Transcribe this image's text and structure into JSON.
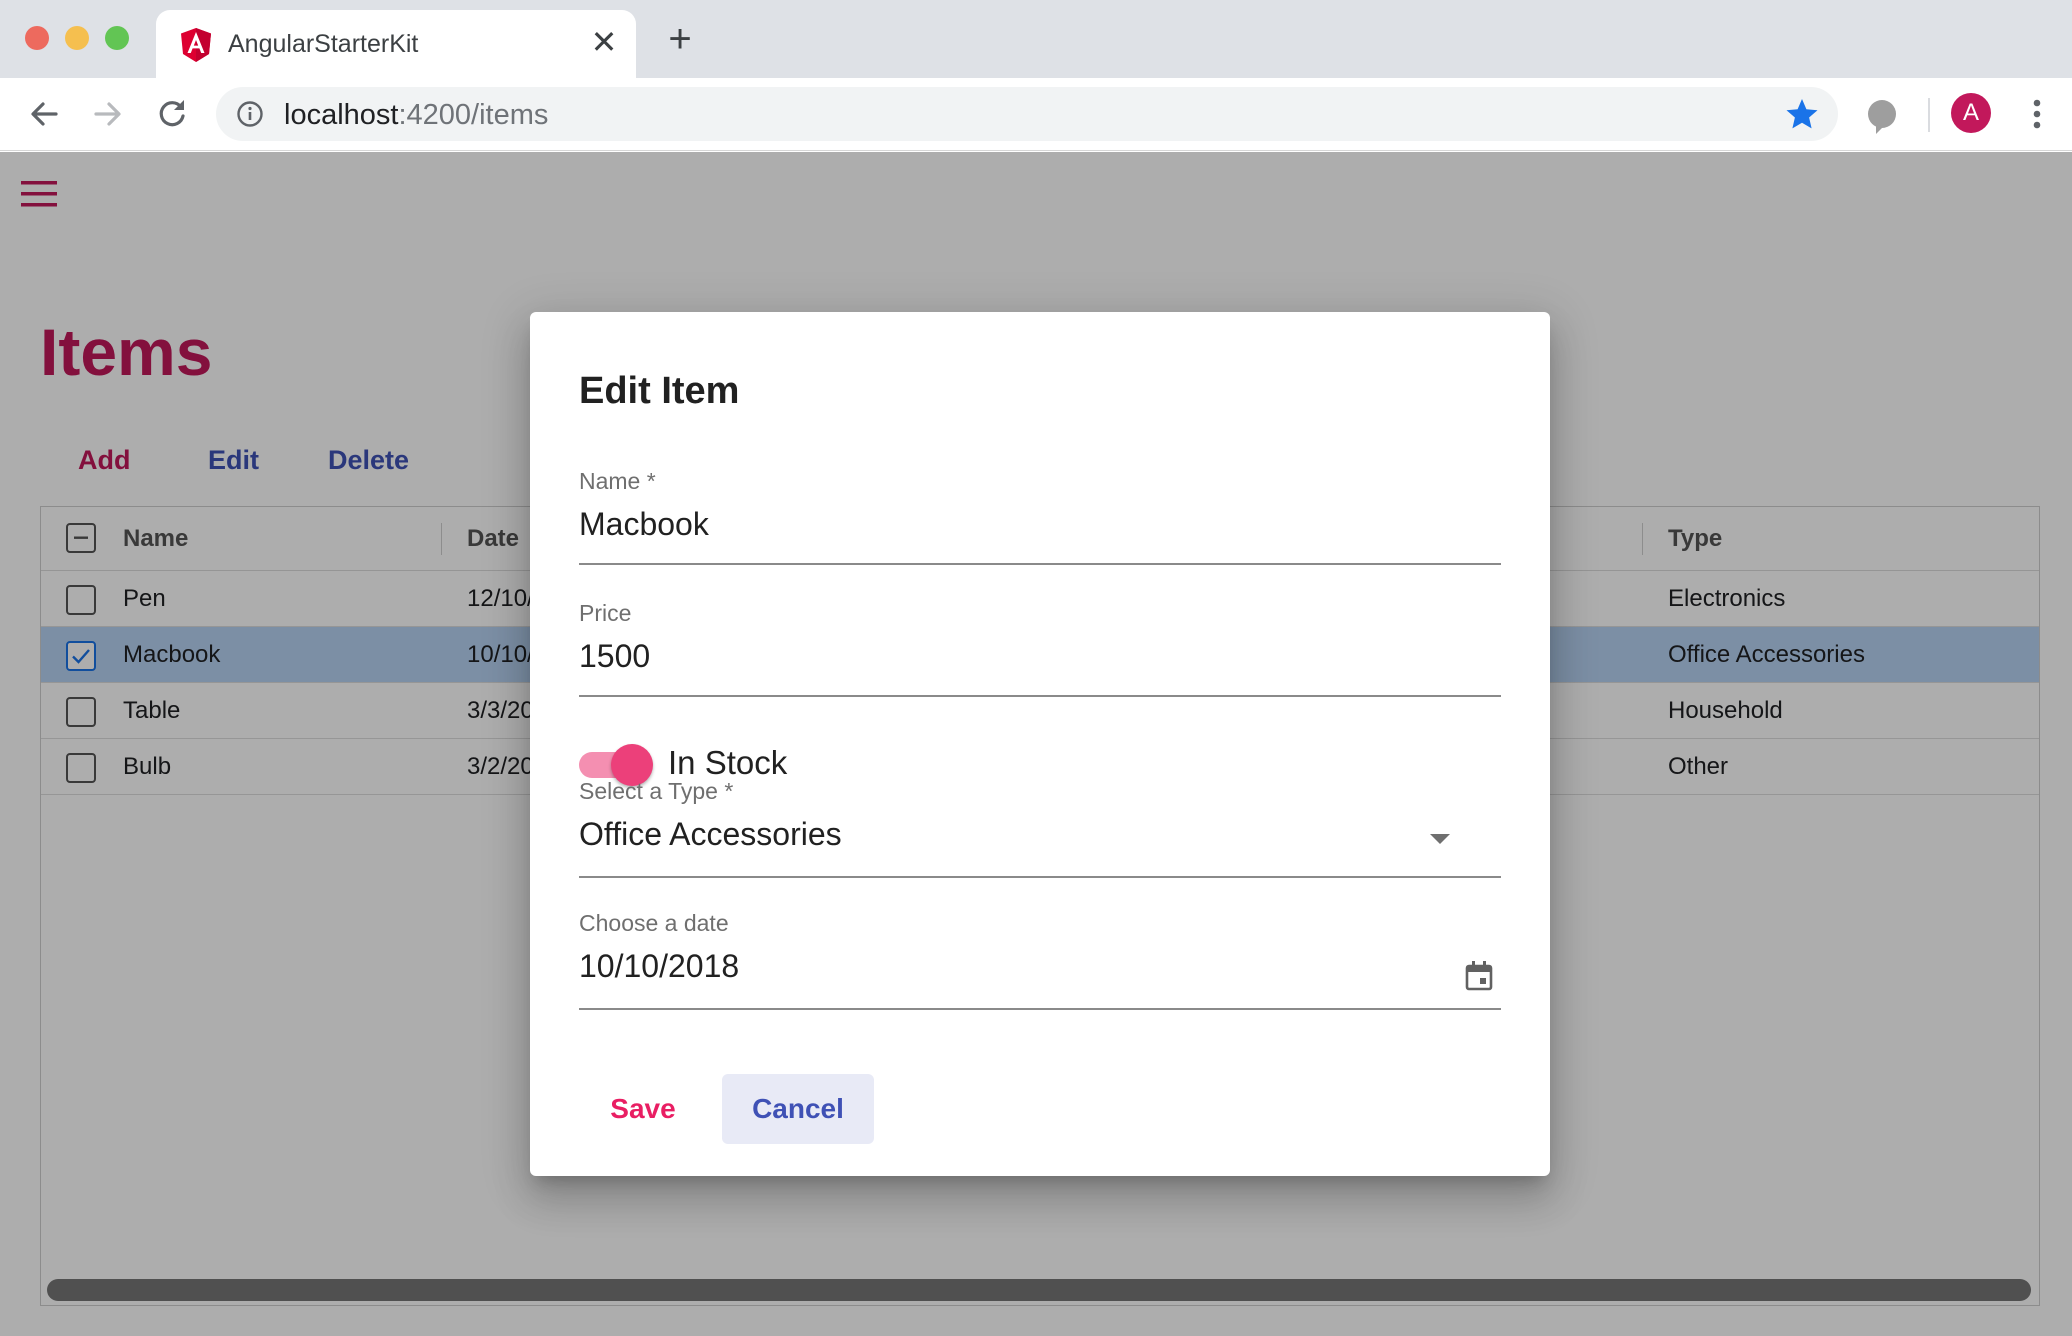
{
  "browser": {
    "tab_title": "AngularStarterKit",
    "tab_close": "✕",
    "new_tab": "+",
    "url_host": "localhost",
    "url_rest": ":4200/items",
    "avatar_letter": "A"
  },
  "page": {
    "title": "Items",
    "actions": {
      "add": "Add",
      "edit": "Edit",
      "delete": "Delete"
    }
  },
  "grid": {
    "columns": [
      "Name",
      "Date",
      "Type"
    ],
    "rows": [
      {
        "name": "Pen",
        "date": "12/10/",
        "type": "Electronics",
        "checked": false
      },
      {
        "name": "Macbook",
        "date": "10/10/",
        "type": "Office Accessories",
        "checked": true
      },
      {
        "name": "Table",
        "date": "3/3/20",
        "type": "Household",
        "checked": false
      },
      {
        "name": "Bulb",
        "date": "3/2/20",
        "type": "Other",
        "checked": false
      }
    ]
  },
  "dialog": {
    "title": "Edit Item",
    "name_label": "Name *",
    "name_value": "Macbook",
    "price_label": "Price",
    "price_value": "1500",
    "in_stock_label": "In Stock",
    "in_stock": true,
    "type_label": "Select a Type *",
    "type_value": "Office Accessories",
    "date_label": "Choose a date",
    "date_value": "10/10/2018",
    "save_label": "Save",
    "cancel_label": "Cancel"
  },
  "colors": {
    "primary_pink": "#c2185b",
    "accent_pink": "#e91e63",
    "indigo": "#3f51b5",
    "selected_row": "#b7d3f4"
  },
  "icons": [
    "angular-logo-icon",
    "back-icon",
    "forward-icon",
    "reload-icon",
    "info-icon",
    "bookmark-star-icon",
    "extension-icon",
    "kebab-menu-icon",
    "hamburger-menu-icon",
    "dropdown-arrow-icon",
    "calendar-icon"
  ]
}
